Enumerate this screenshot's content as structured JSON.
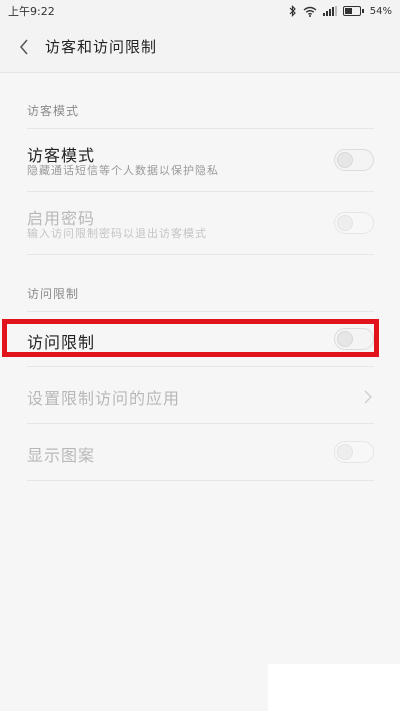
{
  "status_bar": {
    "time": "上午9:22",
    "battery_text": "54%",
    "battery_level": 0.54,
    "icons": [
      "bluetooth-icon",
      "wifi-icon",
      "signal-icon",
      "battery-icon"
    ]
  },
  "header": {
    "back_icon": "back-arrow-icon",
    "title": "访客和访问限制"
  },
  "sections": {
    "guest": {
      "header": "访客模式",
      "items": [
        {
          "title": "访客模式",
          "subtitle": "隐藏通话短信等个人数据以保护隐私",
          "enabled": true,
          "toggle_on": false
        },
        {
          "title": "启用密码",
          "subtitle": "输入访问限制密码以退出访客模式",
          "enabled": false,
          "toggle_on": false
        }
      ]
    },
    "restriction": {
      "header": "访问限制",
      "items": [
        {
          "title": "访问限制",
          "enabled": true,
          "toggle_on": false,
          "highlighted": true
        },
        {
          "title": "设置限制访问的应用",
          "enabled": false,
          "control": "chevron-right-icon"
        },
        {
          "title": "显示图案",
          "enabled": false,
          "toggle_on": false
        }
      ]
    }
  },
  "colors": {
    "highlight": "#e1141b",
    "background": "#f6f6f6"
  }
}
